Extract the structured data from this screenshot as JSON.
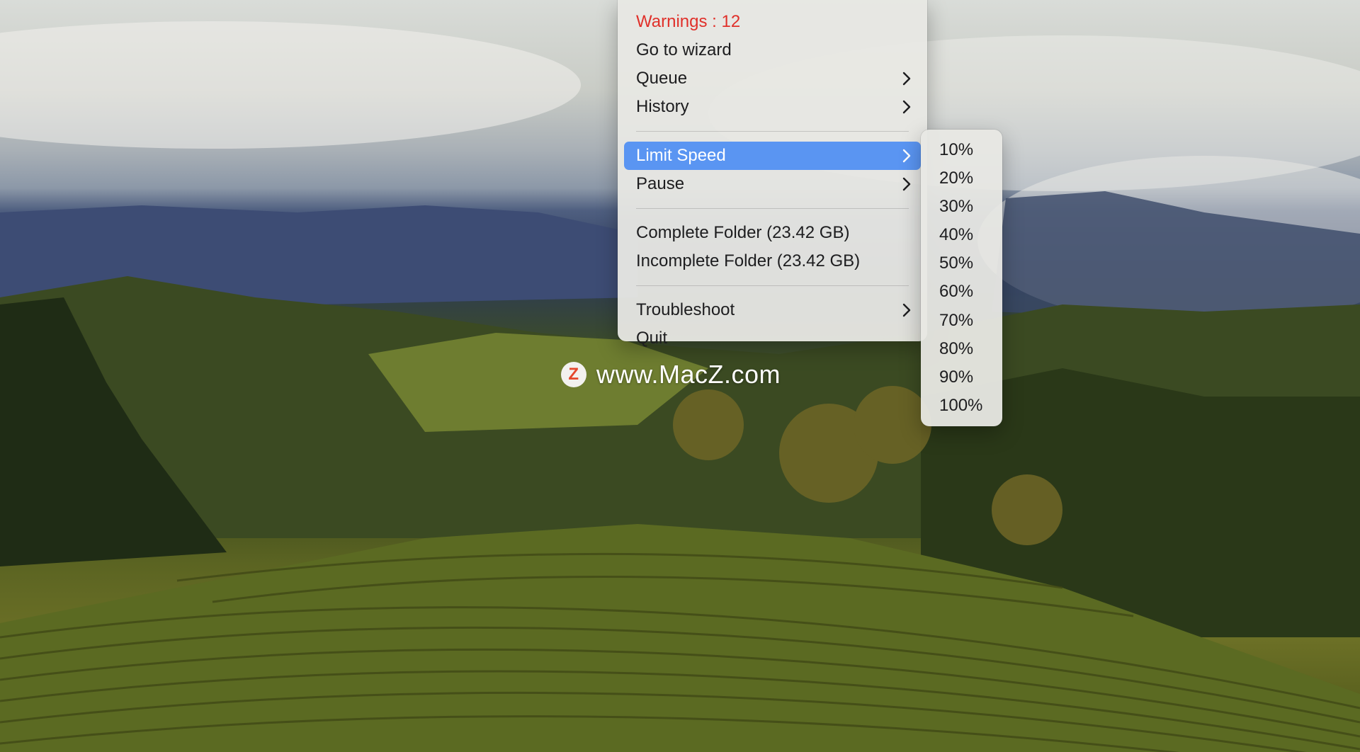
{
  "menu": {
    "warnings_label": "Warnings : 12",
    "go_to_wizard": "Go to wizard",
    "queue": "Queue",
    "history": "History",
    "limit_speed": "Limit Speed",
    "pause": "Pause",
    "complete_folder": "Complete Folder (23.42 GB)",
    "incomplete_folder": "Incomplete Folder (23.42 GB)",
    "troubleshoot": "Troubleshoot",
    "quit": "Quit"
  },
  "submenu": {
    "items": [
      "10%",
      "20%",
      "30%",
      "40%",
      "50%",
      "60%",
      "70%",
      "80%",
      "90%",
      "100%"
    ]
  },
  "watermark": {
    "logo_letter": "Z",
    "text": "www.MacZ.com"
  },
  "colors": {
    "warning": "#e0302a",
    "selection": "#5a95f2",
    "menu_background": "#e8e8e4"
  }
}
